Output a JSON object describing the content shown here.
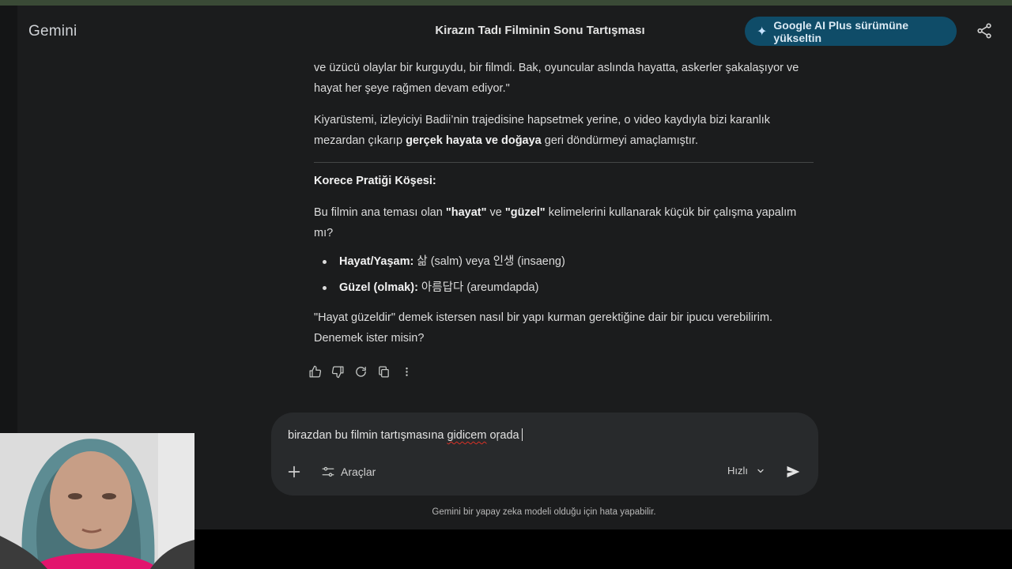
{
  "header": {
    "brand": "Gemini",
    "chat_title": "Kirazın Tadı Filminin Sonu Tartışması",
    "upgrade_label": "Google AI Plus sürümüne yükseltin",
    "icons": [
      "sparkle-icon",
      "share-icon"
    ]
  },
  "response": {
    "p1": "ve üzücü olaylar bir kurguydu, bir filmdi. Bak, oyuncular aslında hayatta, askerler şakalaşıyor ve hayat her şeye rağmen devam ediyor.\"",
    "p2_a": "Kiyarüstemi, izleyiciyi Badii’nin trajedisine hapsetmek yerine, o video kaydıyla bizi karanlık mezardan çıkarıp ",
    "p2_bold": "gerçek hayata ve doğaya",
    "p2_b": " geri döndürmeyi amaçlamıştır.",
    "heading": "Korece Pratiği Köşesi:",
    "p3_a": "Bu filmin ana teması olan ",
    "p3_w1": "\"hayat\"",
    "p3_mid": " ve ",
    "p3_w2": "\"güzel\"",
    "p3_b": " kelimelerini kullanarak küçük bir çalışma yapalım mı?",
    "bullets": [
      {
        "term": "Hayat/Yaşam:",
        "text": " 삶 (salm) veya 인생 (insaeng)"
      },
      {
        "term": "Güzel (olmak):",
        "text": " 아름답다 (areumdapda)"
      }
    ],
    "p4": "\"Hayat güzeldir\" demek istersen nasıl bir yapı kurman gerektiğine dair bir ipucu verebilirim. Denemek ister misin?"
  },
  "actions": [
    "thumbs-up-icon",
    "thumbs-down-icon",
    "regenerate-icon",
    "copy-icon",
    "more-vert-icon"
  ],
  "composer": {
    "text_a": "birazdan bu filmin tartışmasına ",
    "text_typo": "gidicem",
    "text_b": " oŗada",
    "tools_label": "Araçlar",
    "mode_label": "Hızlı"
  },
  "footer": {
    "disclaimer": "Gemini bir yapay zeka modeli olduğu için hata yapabilir."
  }
}
